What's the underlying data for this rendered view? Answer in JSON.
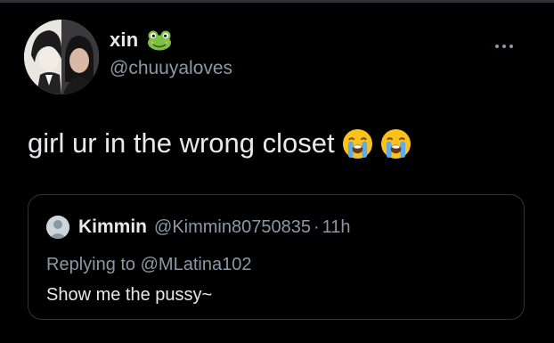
{
  "tweet": {
    "author": {
      "display_name": "xin",
      "name_emoji": "frog-icon",
      "handle": "@chuuyaloves"
    },
    "text": "girl ur in the wrong closet",
    "text_emojis": [
      "loudly-crying-face-icon",
      "loudly-crying-face-icon"
    ],
    "more_icon": "more-horizontal-icon"
  },
  "quote": {
    "display_name": "Kimmin",
    "handle": "@Kimmin80750835",
    "separator": "·",
    "time": "11h",
    "replying_prefix": "Replying to",
    "replying_to": "@MLatina102",
    "text": "Show me the pussy~"
  },
  "colors": {
    "background": "#000000",
    "primary_text": "#e7e9ea",
    "secondary_text": "#8b98a5",
    "border": "#2f3336"
  }
}
